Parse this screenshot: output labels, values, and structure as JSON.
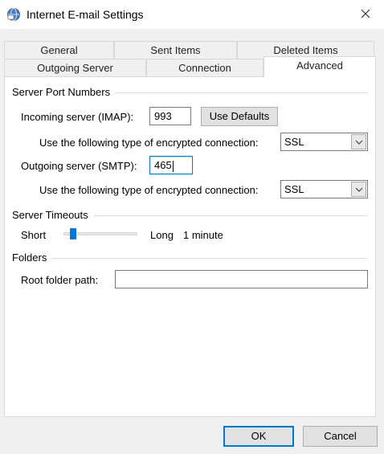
{
  "window": {
    "title": "Internet E-mail Settings",
    "icons": {
      "app": "globe-mail-icon",
      "close": "close-icon"
    }
  },
  "tabs": {
    "row1": [
      "General",
      "Sent Items",
      "Deleted Items"
    ],
    "row2": [
      "Outgoing Server",
      "Connection",
      "Advanced"
    ],
    "active": "Advanced"
  },
  "server_ports": {
    "group_title": "Server Port Numbers",
    "incoming_label": "Incoming server (IMAP):",
    "incoming_value": "993",
    "use_defaults_label": "Use Defaults",
    "encryption_label": "Use the following type of encrypted connection:",
    "incoming_encryption": "SSL",
    "outgoing_label": "Outgoing server (SMTP):",
    "outgoing_value": "465",
    "outgoing_encryption": "SSL"
  },
  "timeouts": {
    "group_title": "Server Timeouts",
    "short_label": "Short",
    "long_label": "Long",
    "value_text": "1 minute",
    "slider_fraction": 0.1
  },
  "folders": {
    "group_title": "Folders",
    "root_label": "Root folder path:",
    "root_value": ""
  },
  "footer": {
    "ok_label": "OK",
    "cancel_label": "Cancel"
  },
  "colors": {
    "accent": "#0078d7",
    "panel_bg": "#ffffff",
    "dialog_bg": "#f0f0f0",
    "button_bg": "#e1e1e1"
  }
}
